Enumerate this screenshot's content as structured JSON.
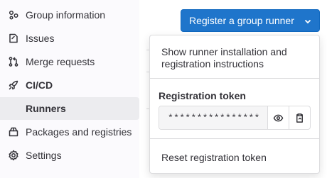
{
  "sidebar": {
    "items": [
      {
        "label": "Group information",
        "icon": "group-icon"
      },
      {
        "label": "Issues",
        "icon": "issues-icon"
      },
      {
        "label": "Merge requests",
        "icon": "merge-request-icon"
      },
      {
        "label": "CI/CD",
        "icon": "rocket-icon"
      },
      {
        "label": "Runners",
        "icon": ""
      },
      {
        "label": "Packages and registries",
        "icon": "package-icon"
      },
      {
        "label": "Settings",
        "icon": "gear-icon"
      }
    ]
  },
  "toolbar": {
    "register_label": "Register a group runner"
  },
  "dropdown": {
    "instructions_label": "Show runner installation and registration instructions",
    "token_heading": "Registration token",
    "token_value": "****************",
    "reset_label": "Reset registration token"
  },
  "colors": {
    "primary": "#1f75cb",
    "sidebar_bg": "#fbfafd",
    "active_bg": "#ececef",
    "border": "#dcdcde"
  }
}
